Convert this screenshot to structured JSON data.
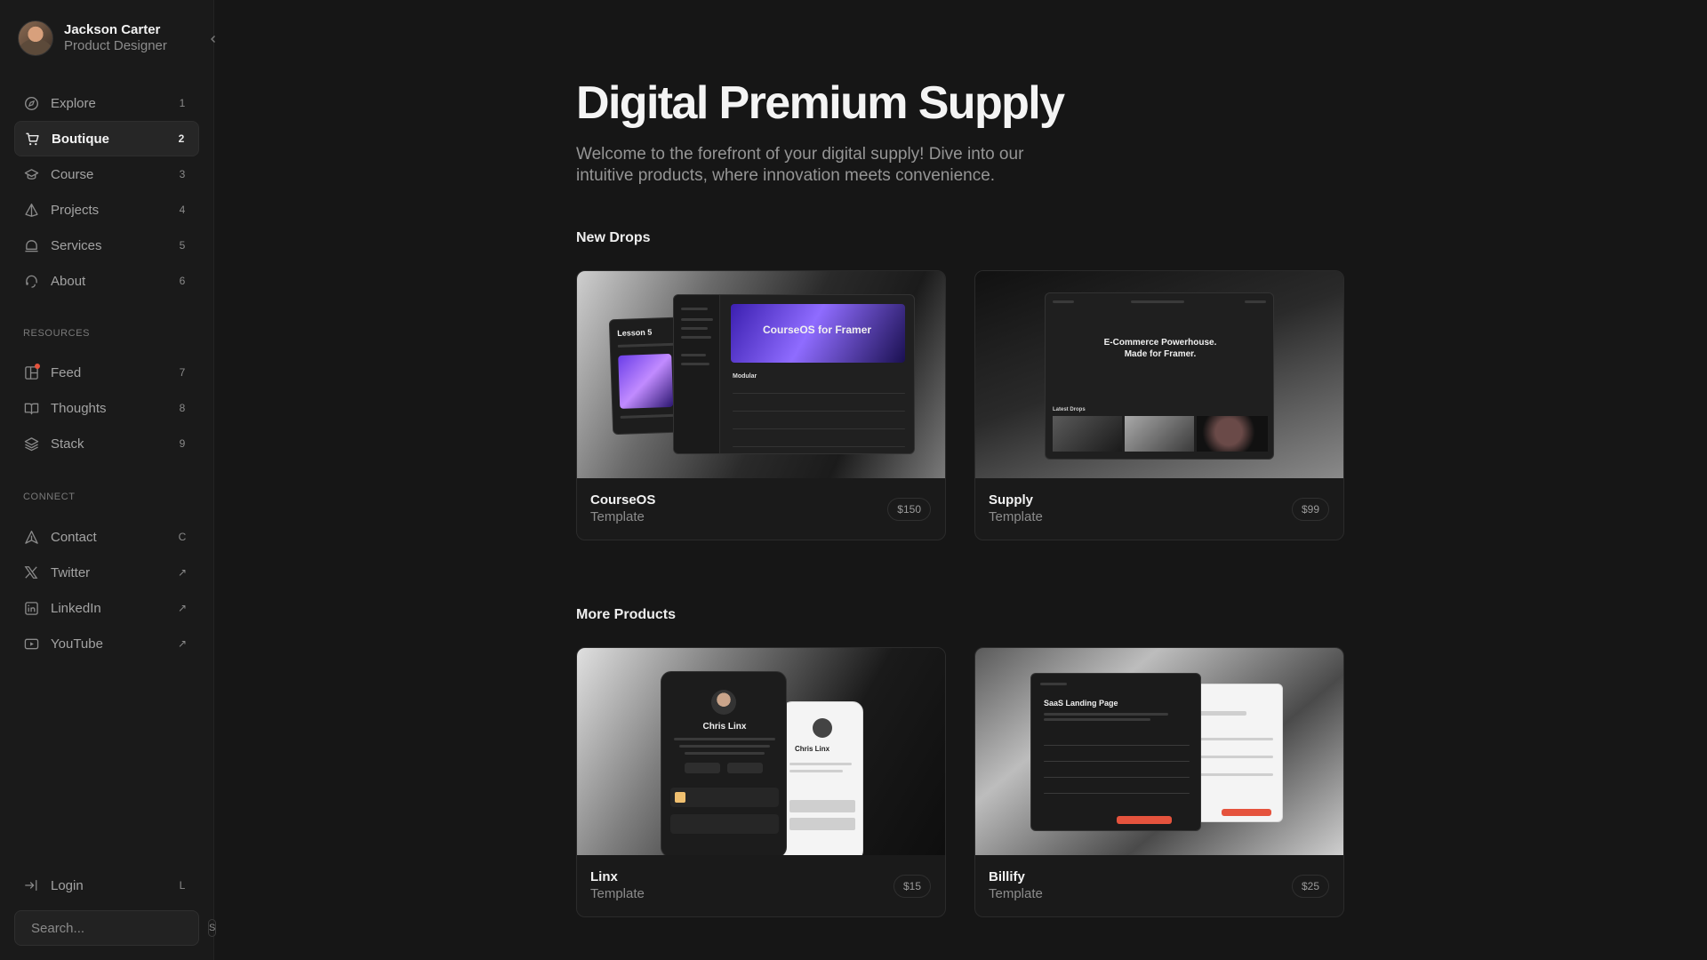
{
  "profile": {
    "name": "Jackson Carter",
    "role": "Product Designer",
    "collapse_icon": "chevron-left-icon"
  },
  "nav": {
    "primary": [
      {
        "label": "Explore",
        "key": "1",
        "icon": "compass-icon"
      },
      {
        "label": "Boutique",
        "key": "2",
        "icon": "cart-icon",
        "active": true
      },
      {
        "label": "Course",
        "key": "3",
        "icon": "graduation-cap-icon"
      },
      {
        "label": "Projects",
        "key": "4",
        "icon": "pyramid-icon"
      },
      {
        "label": "Services",
        "key": "5",
        "icon": "bell-icon"
      },
      {
        "label": "About",
        "key": "6",
        "icon": "headset-icon"
      }
    ],
    "resources_label": "RESOURCES",
    "resources": [
      {
        "label": "Feed",
        "key": "7",
        "icon": "feed-icon"
      },
      {
        "label": "Thoughts",
        "key": "8",
        "icon": "book-icon"
      },
      {
        "label": "Stack",
        "key": "9",
        "icon": "layers-icon"
      }
    ],
    "connect_label": "CONNECT",
    "connect": [
      {
        "label": "Contact",
        "key": "C",
        "icon": "send-icon"
      },
      {
        "label": "Twitter",
        "key": "↗",
        "icon": "x-logo-icon"
      },
      {
        "label": "LinkedIn",
        "key": "↗",
        "icon": "linkedin-icon"
      },
      {
        "label": "YouTube",
        "key": "↗",
        "icon": "youtube-icon"
      }
    ],
    "login": {
      "label": "Login",
      "key": "L",
      "icon": "login-arrow-icon"
    }
  },
  "search": {
    "placeholder": "Search...",
    "key": "S"
  },
  "page": {
    "title": "Digital Premium Supply",
    "intro": "Welcome to the forefront of your digital supply! Dive into our intuitive products, where innovation meets convenience."
  },
  "sections": {
    "new_drops": "New Drops",
    "more_products": "More Products"
  },
  "products": {
    "courseos": {
      "name": "CourseOS",
      "type": "Template",
      "price": "$150",
      "mock": {
        "headline": "CourseOS for Framer",
        "lesson": "Lesson 5",
        "module": "Modular"
      }
    },
    "supply": {
      "name": "Supply",
      "type": "Template",
      "price": "$99",
      "mock": {
        "headline_1": "E-Commerce Powerhouse.",
        "headline_2": "Made for Framer.",
        "sub": "Latest Drops"
      }
    },
    "linx": {
      "name": "Linx",
      "type": "Template",
      "price": "$15",
      "mock": {
        "person": "Chris Linx"
      }
    },
    "billify": {
      "name": "Billify",
      "type": "Template",
      "price": "$25",
      "mock": {
        "headline": "SaaS Landing Page"
      }
    }
  },
  "colors": {
    "background": "#161616",
    "sidebar": "#1a1a1a",
    "accent_orange": "#e5533d"
  }
}
